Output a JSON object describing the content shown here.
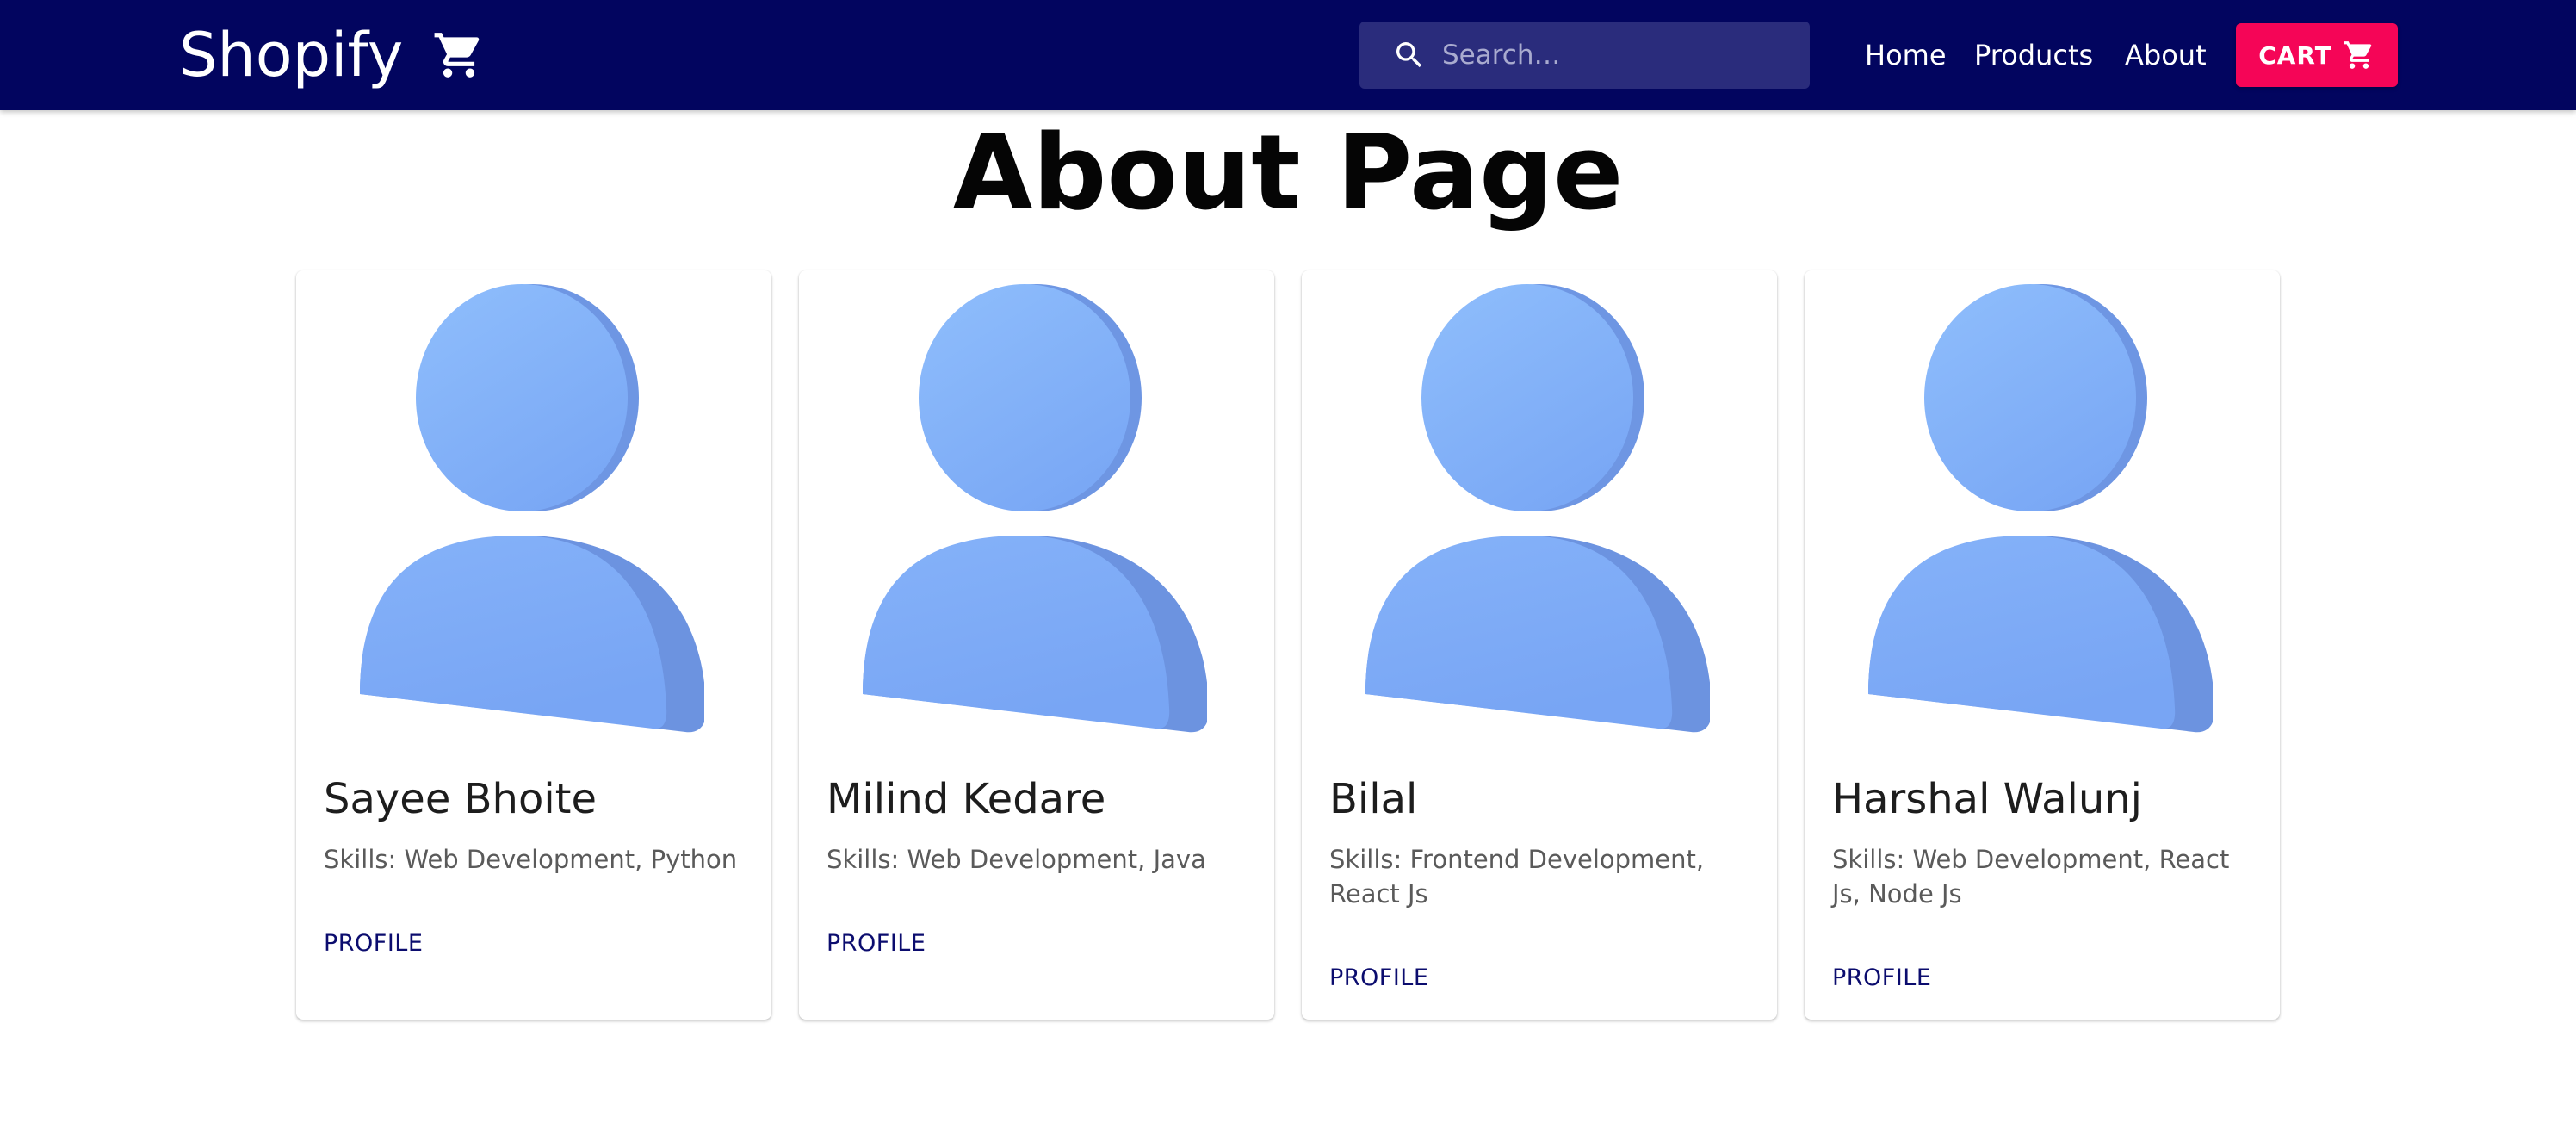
{
  "header": {
    "brand": "Shopify",
    "brand_icon": "cart-icon",
    "search": {
      "placeholder": "Search…",
      "value": ""
    },
    "nav": [
      {
        "label": "Home"
      },
      {
        "label": "Products"
      },
      {
        "label": "About"
      }
    ],
    "cart_button": {
      "label": "CART",
      "icon": "cart-icon"
    }
  },
  "main": {
    "title": "About Page",
    "members": [
      {
        "name": "Sayee Bhoite",
        "skills": "Skills: Web Development, Python",
        "link": "PROFILE",
        "icon": "avatar-person-icon"
      },
      {
        "name": "Milind Kedare",
        "skills": "Skills: Web Development, Java",
        "link": "PROFILE",
        "icon": "avatar-person-icon"
      },
      {
        "name": "Bilal",
        "skills": "Skills: Frontend Development, React Js",
        "link": "PROFILE",
        "icon": "avatar-person-icon"
      },
      {
        "name": "Harshal Walunj",
        "skills": "Skills: Web Development, React Js, Node Js",
        "link": "PROFILE",
        "icon": "avatar-person-icon"
      }
    ]
  },
  "colors": {
    "navbar": "#02055f",
    "search_bg": "#2a2c7c",
    "cart_button": "#f50557",
    "profile_link": "#0b0c6e",
    "avatar": "#82adf6"
  }
}
